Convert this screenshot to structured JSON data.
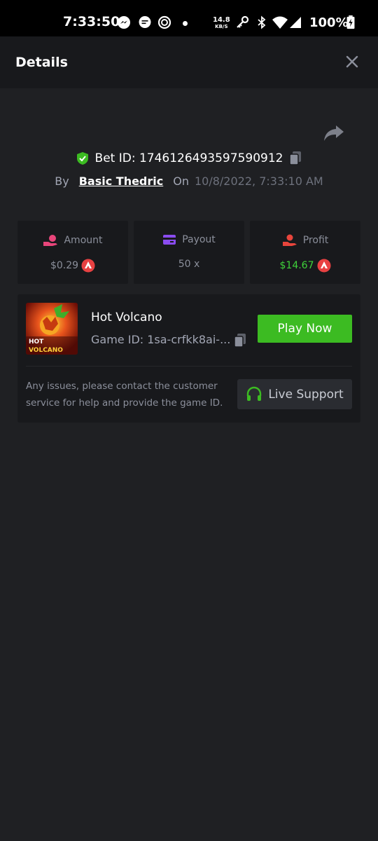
{
  "status_bar": {
    "time": "7:33:50",
    "net_speed": "14.8",
    "net_unit": "KB/S",
    "battery": "100%"
  },
  "header": {
    "title": "Details"
  },
  "bet": {
    "id": "Bet ID: 1746126493597590912",
    "by_label": "By",
    "user": "Basic Thedric",
    "on_label": "On",
    "date": "10/8/2022, 7:33:10 AM"
  },
  "stats": [
    {
      "label": "Amount",
      "value": "$0.29",
      "icon": "money-hand-icon",
      "color": "#e8457a"
    },
    {
      "label": "Payout",
      "value": "50 x",
      "icon": "card-icon",
      "color": "#8a4cf0"
    },
    {
      "label": "Profit",
      "value": "$14.67",
      "icon": "profit-hand-icon",
      "color": "#e8453c"
    }
  ],
  "game": {
    "name": "Hot Volcano",
    "game_id": "Game ID: 1sa-crfkk8ai-...",
    "thumb_line1": "HOT",
    "thumb_line2": "VOLCANO",
    "play_label": "Play Now"
  },
  "support": {
    "text": "Any issues, please contact the customer service for help and provide the game ID.",
    "button_label": "Live Support"
  },
  "colors": {
    "accent_green": "#3cbb22",
    "profit_green": "#3fd23a",
    "coin_red": "#e84142",
    "background": "#1f2023",
    "card": "#18191c"
  }
}
